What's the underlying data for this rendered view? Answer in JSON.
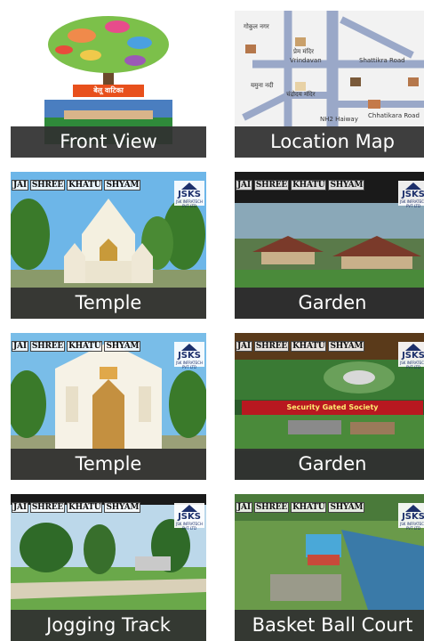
{
  "tiles": [
    {
      "caption": "Front View",
      "image": "tree-logo-and-gate"
    },
    {
      "caption": "Location Map",
      "image": "map"
    },
    {
      "caption": "Temple",
      "image": "temple-render"
    },
    {
      "caption": "Garden",
      "image": "garden-render"
    },
    {
      "caption": "Temple",
      "image": "temple-render-closeup"
    },
    {
      "caption": "Garden",
      "image": "garden-aerial"
    },
    {
      "caption": "Jogging Track",
      "image": "jogging-track-render"
    },
    {
      "caption": "Basket Ball Court",
      "image": "basketball-court-render"
    }
  ],
  "watermark": {
    "words": [
      "JAI",
      "SHREE",
      "KHATU",
      "SHYAM"
    ],
    "logo_text": "JSKS",
    "logo_sub": "JSK INFRATECH PVT LTD"
  },
  "front_view": {
    "tree_label": "बेलू वाटिका"
  },
  "garden_aerial": {
    "banner": "Security Gated Society"
  },
  "location_map": {
    "labels": [
      "गोकुल नगर",
      "प्रेम मंदिर",
      "Vrindavan",
      "Shattikra Road",
      "यमुना नदी",
      "चंद्रोदय मंदिर",
      "NH2 Haiway",
      "Chhatikara Road"
    ]
  },
  "colors": {
    "caption_bg": "#303030",
    "caption_text": "#ffffff"
  }
}
